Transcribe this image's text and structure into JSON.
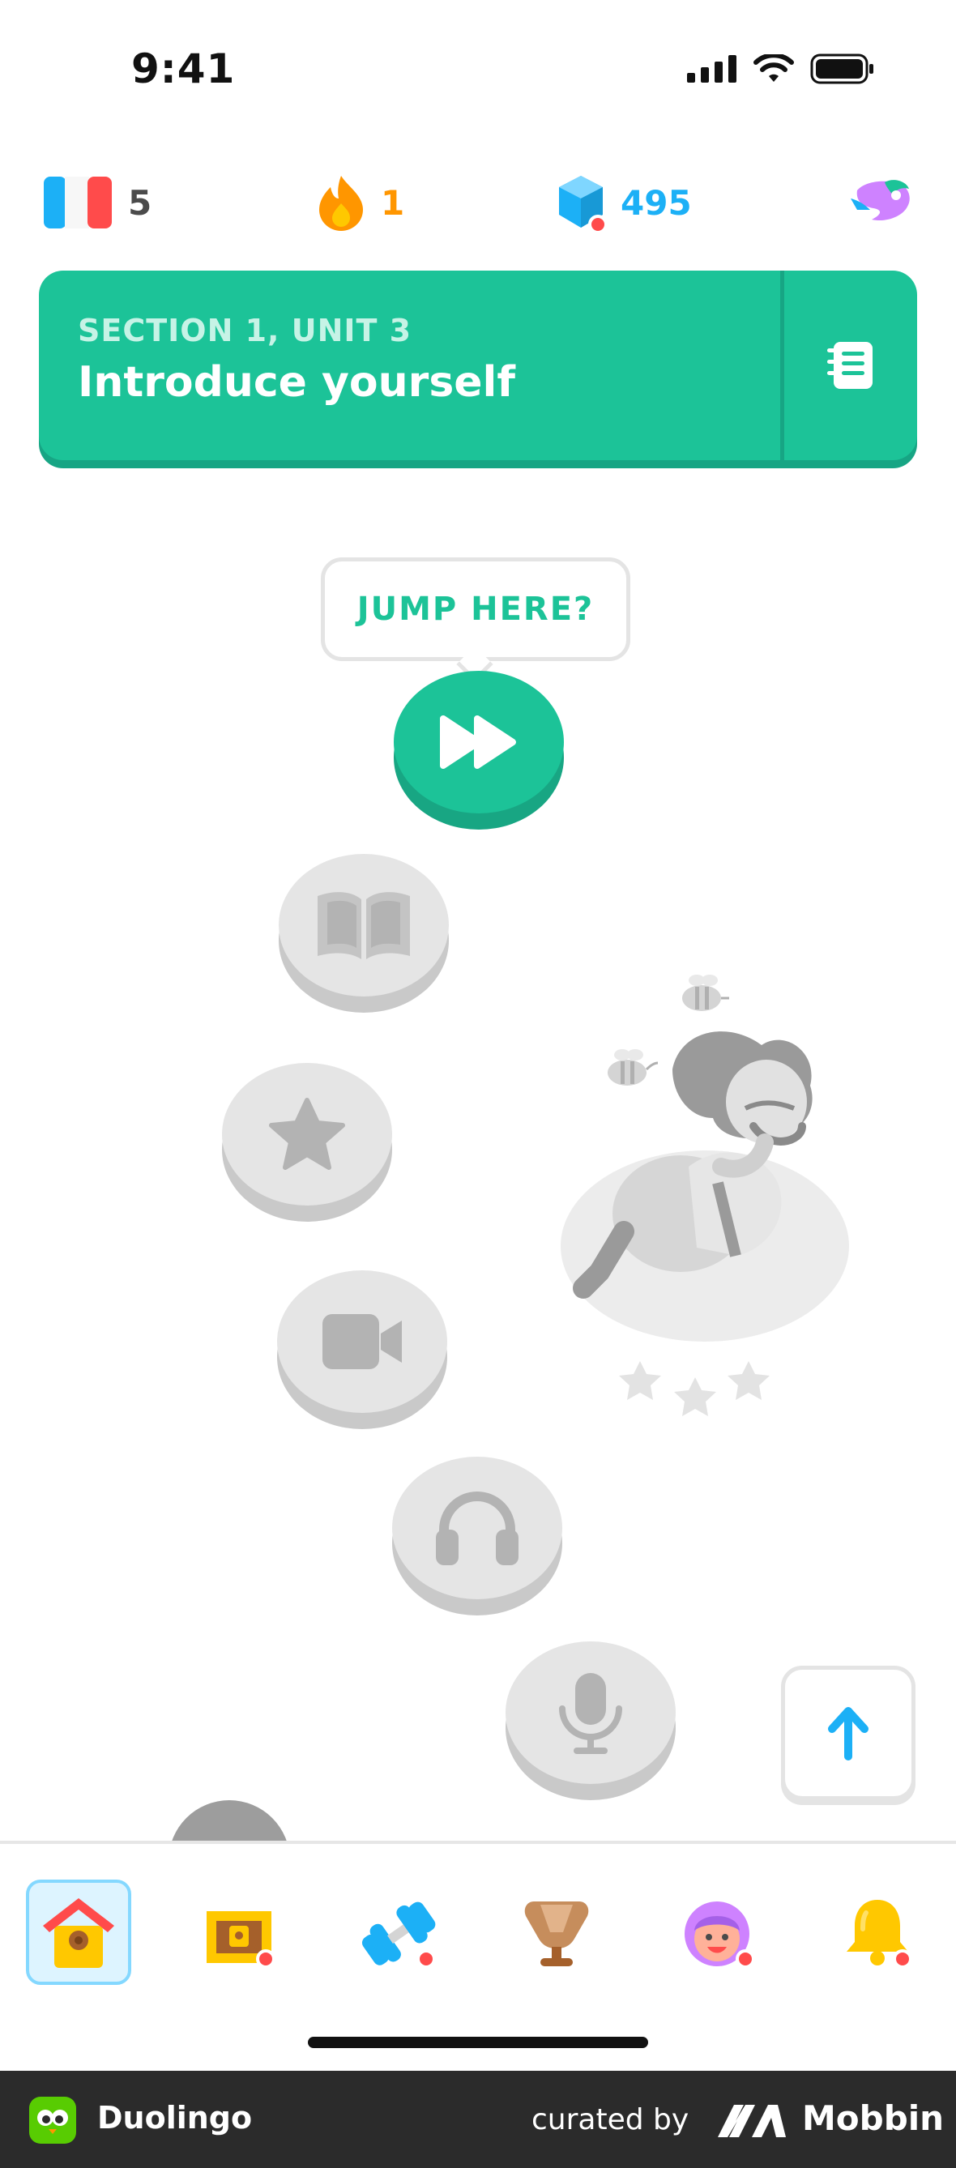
{
  "status_bar": {
    "time": "9:41"
  },
  "stats": {
    "course_language": "5",
    "streak": "1",
    "gems": "495"
  },
  "unit": {
    "section": "SECTION 1, UNIT 3",
    "title": "Introduce yourself"
  },
  "path": {
    "jump_label": "JUMP HERE?",
    "nodes": [
      "fast-forward",
      "book",
      "star",
      "video",
      "headphones",
      "microphone"
    ]
  },
  "nav": {
    "items": [
      "home",
      "treasure",
      "practice",
      "leaderboard",
      "profile",
      "notifications"
    ],
    "active": "home"
  },
  "footer": {
    "app_name": "Duolingo",
    "curated": "curated by",
    "brand": "Mobbin"
  },
  "colors": {
    "brand_green": "#1cc398",
    "streak_orange": "#ff9600",
    "gem_blue": "#1cb0f6",
    "node_grey": "#e5e5e5",
    "notification_red": "#ff4b4b"
  }
}
